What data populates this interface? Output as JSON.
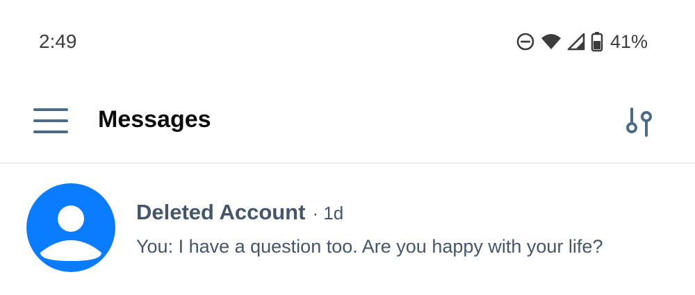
{
  "status_bar": {
    "time": "2:49",
    "icons": [
      "do-not-disturb-icon",
      "wifi-icon",
      "cell-signal-icon",
      "battery-icon"
    ],
    "battery_percent": "41%"
  },
  "header": {
    "title": "Messages",
    "menu_icon": "hamburger-menu-icon",
    "filter_icon": "filter-sliders-icon"
  },
  "messages": [
    {
      "sender": "Deleted Account",
      "time": "· 1d",
      "preview": "You: I have a question too. Are you happy with your life?",
      "avatar_icon": "person-avatar-icon"
    }
  ],
  "colors": {
    "accent": "#0a7cff",
    "icon": "#4a6a8a",
    "text_secondary": "#44566c",
    "title": "#0b0b0b",
    "divider": "#ececec"
  }
}
